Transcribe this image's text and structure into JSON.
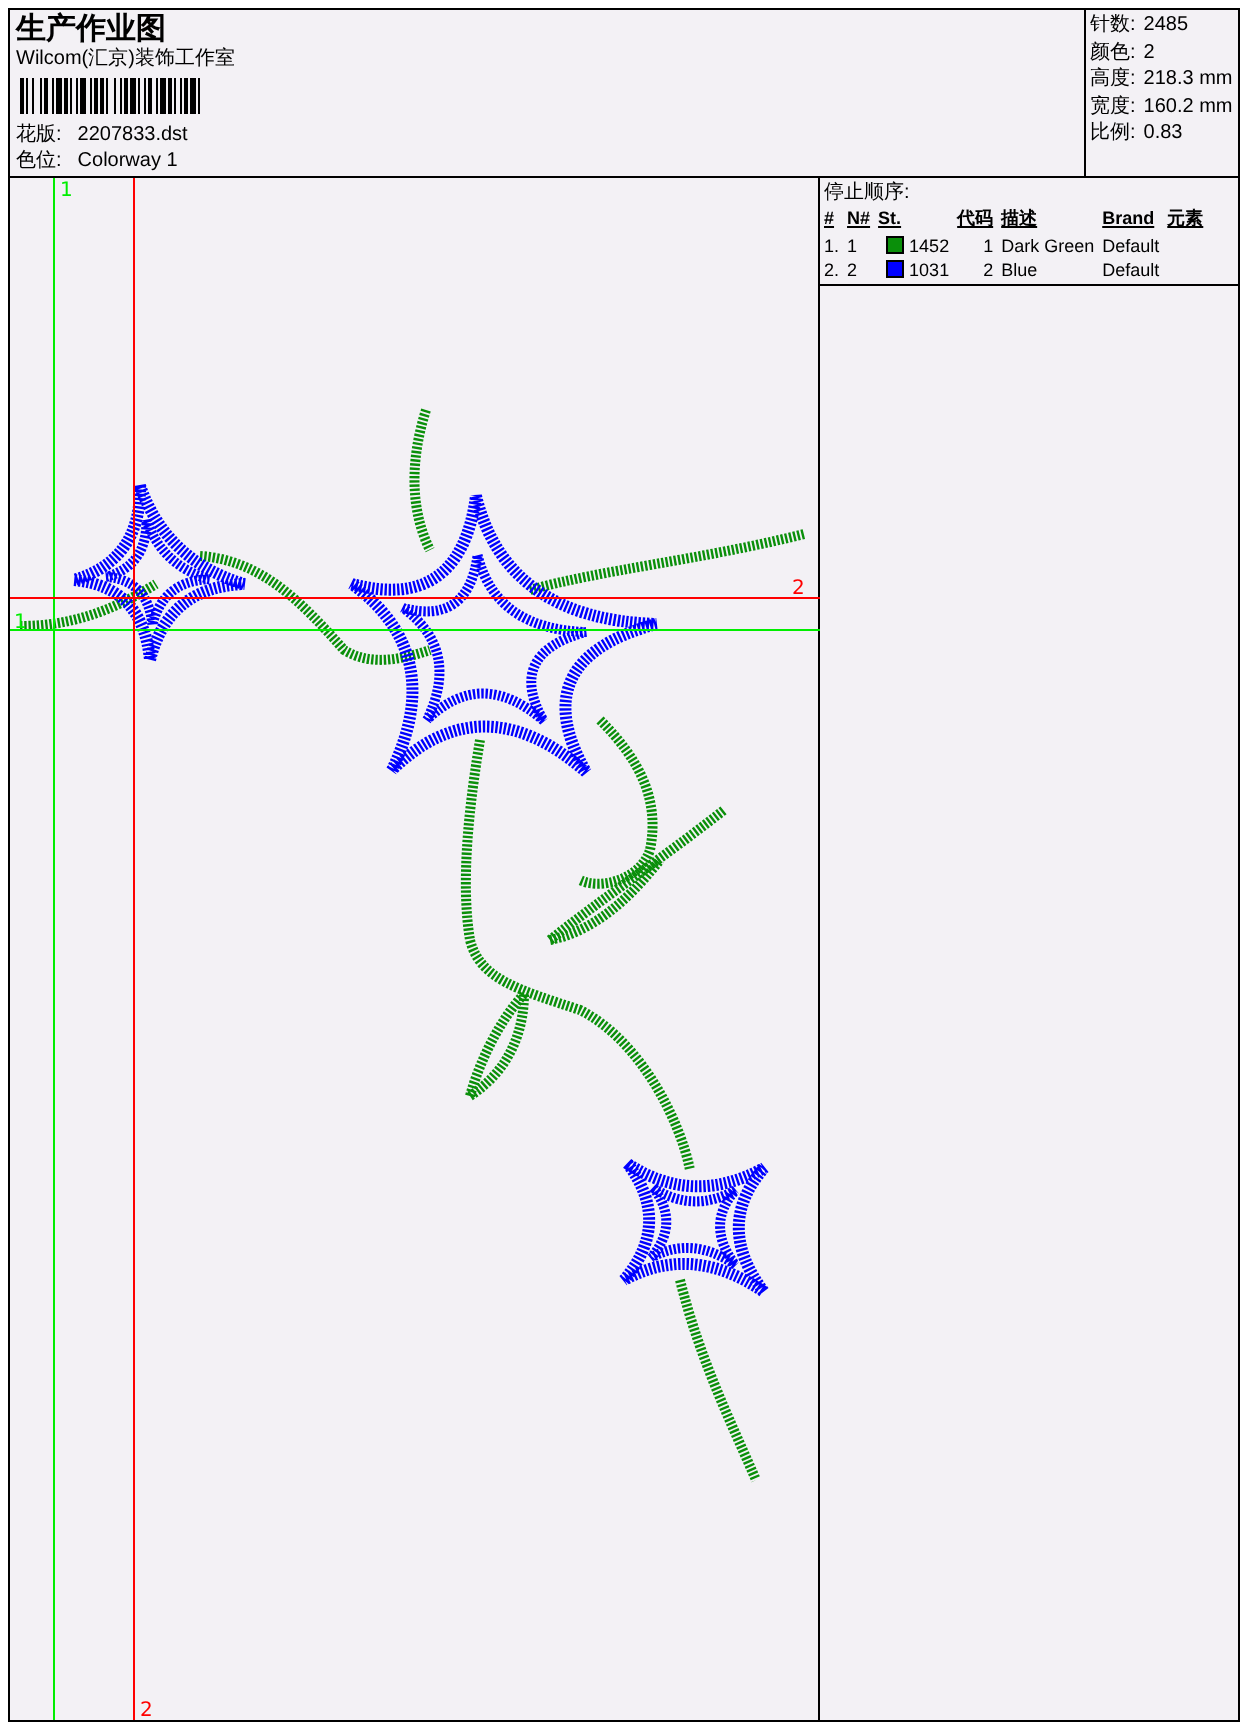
{
  "header": {
    "title": "生产作业图",
    "company": "Wilcom(汇京)装饰工作室",
    "design_label": "花版:",
    "design_value": "2207833.dst",
    "colorway_label": "色位:",
    "colorway_value": "Colorway 1"
  },
  "info": [
    {
      "label": "针数:",
      "value": "2485"
    },
    {
      "label": "颜色:",
      "value": "2"
    },
    {
      "label": "高度:",
      "value": "218.3 mm"
    },
    {
      "label": "宽度:",
      "value": "160.2 mm"
    },
    {
      "label": "比例:",
      "value": "0.83"
    }
  ],
  "guides": [
    {
      "kind": "vertical",
      "label": "1",
      "color": "#00ee00"
    },
    {
      "kind": "horizontal",
      "label": "1",
      "color": "#00ee00"
    },
    {
      "kind": "vertical",
      "label": "2",
      "color": "#ff0000"
    },
    {
      "kind": "horizontal",
      "label": "2",
      "color": "#ff0000"
    }
  ],
  "stop_sequence": {
    "title": "停止顺序:",
    "columns": [
      "#",
      "N#",
      "St.",
      "代码",
      "描述",
      "Brand",
      "元素"
    ],
    "rows": [
      {
        "index": "1.",
        "needle": "1",
        "color": "#0a8f0a",
        "stitches": "1452",
        "code": "1",
        "description": "Dark Green",
        "brand": "Default"
      },
      {
        "index": "2.",
        "needle": "2",
        "color": "#0000ff",
        "stitches": "1031",
        "code": "2",
        "description": "Blue",
        "brand": "Default"
      }
    ]
  }
}
